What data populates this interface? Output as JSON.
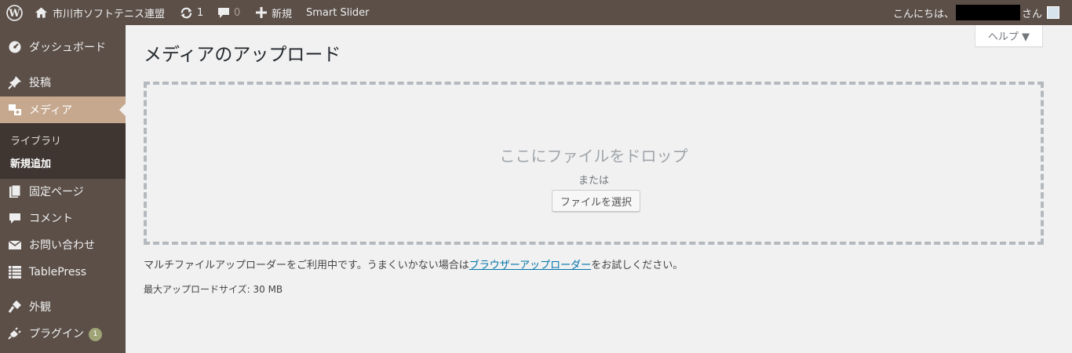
{
  "adminbar": {
    "site_name": "市川市ソフトテニス連盟",
    "updates_count": "1",
    "comments_count": "0",
    "new_label": "新規",
    "smart_slider_label": "Smart Slider",
    "greeting_prefix": "こんにちは、",
    "greeting_suffix": "さん"
  },
  "sidebar": {
    "items": [
      {
        "label": "ダッシュボード",
        "icon": "dashboard-icon"
      },
      {
        "label": "投稿",
        "icon": "pin-icon"
      },
      {
        "label": "メディア",
        "icon": "media-icon"
      },
      {
        "label": "固定ページ",
        "icon": "page-icon"
      },
      {
        "label": "コメント",
        "icon": "comment-icon"
      },
      {
        "label": "お問い合わせ",
        "icon": "mail-icon"
      },
      {
        "label": "TablePress",
        "icon": "table-icon"
      },
      {
        "label": "外観",
        "icon": "appearance-icon"
      },
      {
        "label": "プラグイン",
        "icon": "plugin-icon",
        "badge": "1"
      }
    ],
    "submenu": [
      {
        "label": "ライブラリ"
      },
      {
        "label": "新規追加"
      }
    ]
  },
  "main": {
    "help_label": "ヘルプ ▼",
    "title": "メディアのアップロード",
    "drop_title": "ここにファイルをドロップ",
    "drop_or": "または",
    "select_button": "ファイルを選択",
    "info_before": "マルチファイルアップローダーをご利用中です。うまくいかない場合は",
    "info_link": "ブラウザーアップローダー",
    "info_after": "をお試しください。",
    "max_size": "最大アップロードサイズ: 30 MB"
  },
  "colors": {
    "adminbar_bg": "#5b4f48",
    "active_menu_bg": "#c6a88f",
    "submenu_bg": "#3f3632",
    "link": "#0073aa"
  }
}
